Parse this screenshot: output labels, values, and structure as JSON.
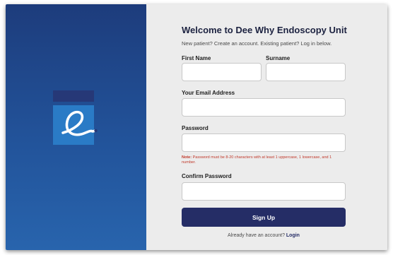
{
  "form": {
    "title": "Welcome to Dee Why Endoscopy Unit",
    "subtitle": "New patient? Create an account. Existing patient? Log in below.",
    "first_name_label": "First Name",
    "first_name_value": "",
    "surname_label": "Surname",
    "surname_value": "",
    "email_label": "Your Email Address",
    "email_value": "",
    "password_label": "Password",
    "password_value": "",
    "password_note_prefix": "Note:",
    "password_note_text": " Password must be 8-20 characters with at least 1 uppercase, 1 lowercase, and 1 number.",
    "confirm_password_label": "Confirm Password",
    "confirm_password_value": "",
    "signup_label": "Sign Up",
    "login_prompt": "Already have an account? ",
    "login_link": "Login"
  },
  "colors": {
    "brand_panel_top": "#1d3c7c",
    "brand_panel_bottom": "#2864ad",
    "logo_square": "#2a7bc6",
    "logo_bar": "#263877",
    "button": "#252d66",
    "note_text": "#c0392b",
    "form_background": "#ececec"
  },
  "icons": {
    "logo": "e-letter-logo-icon"
  }
}
